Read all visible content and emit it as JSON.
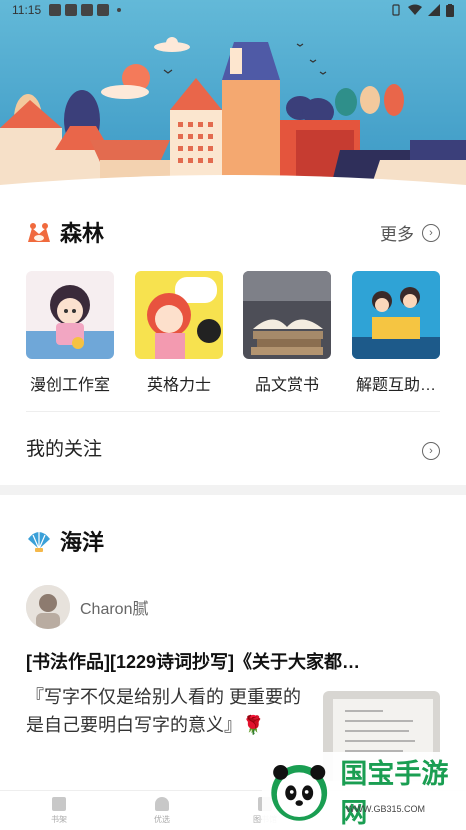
{
  "status": {
    "time": "11:15"
  },
  "forest": {
    "title": "森林",
    "more": "更多",
    "circles": [
      {
        "name": "漫创工作室"
      },
      {
        "name": "英格力士"
      },
      {
        "name": "品文赏书"
      },
      {
        "name": "解题互助…"
      }
    ],
    "follow": "我的关注"
  },
  "ocean": {
    "title": "海洋",
    "post": {
      "username": "Charon腻",
      "title": "[书法作品][1229诗词抄写]《关于大家都…",
      "excerpt": "『写字不仅是给别人看的 更重要的是自己要明白写字的意义』🌹"
    }
  },
  "tabs": [
    {
      "label": "书架"
    },
    {
      "label": "优选"
    },
    {
      "label": "图书馆"
    }
  ],
  "watermark": {
    "text": "国宝手游网",
    "url": "WWW.GB315.COM"
  },
  "colors": {
    "sky": "#4ca8cf",
    "forest_icon": "#f06a3d",
    "ocean_icon": "#3aa0d8",
    "watermark": "#1a9e52"
  }
}
